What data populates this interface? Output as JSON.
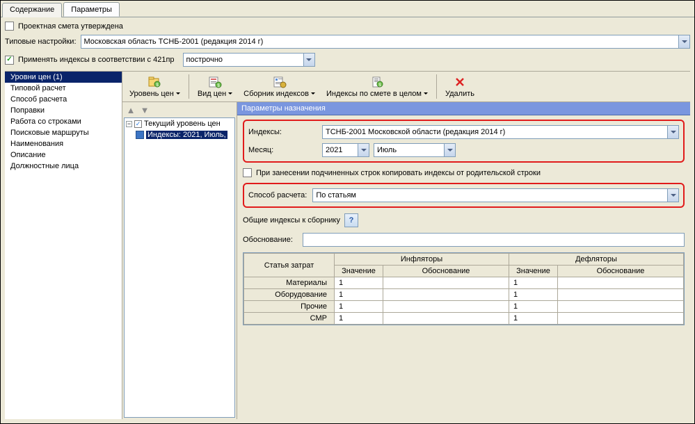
{
  "tabs": {
    "content": "Содержание",
    "params": "Параметры"
  },
  "approved_label": "Проектная смета утверждена",
  "typical_settings_label": "Типовые настройки:",
  "typical_settings_value": "Московская область ТСНБ-2001 (редакция 2014 г)",
  "apply_indexes_label": "Применять индексы в соответствии с 421пр",
  "apply_mode_value": "построчно",
  "leftnav": [
    "Уровни цен (1)",
    "Типовой расчет",
    "Способ расчета",
    "Поправки",
    "Работа со строками",
    "Поисковые маршруты",
    "Наименования",
    "Описание",
    "Должностные лица"
  ],
  "leftnav_selected": 0,
  "toolbar": {
    "level": "Уровень цен",
    "viewtype": "Вид цен",
    "indexbook": "Сборник индексов",
    "estimate_indexes": "Индексы по смете в целом",
    "delete": "Удалить"
  },
  "tree": {
    "root": "Текущий уровень цен",
    "child": "Индексы: 2021, Июль,"
  },
  "params_header": "Параметры назначения",
  "form": {
    "indexes_label": "Индексы:",
    "indexes_value": "ТСНБ-2001 Московской области (редакция 2014 г)",
    "month_label": "Месяц:",
    "year_value": "2021",
    "month_value": "Июль",
    "copy_checkbox_label": "При занесении подчиненных строк копировать индексы от родительской строки",
    "calc_method_label": "Способ расчета:",
    "calc_method_value": "По статьям",
    "general_indexes_label": "Общие индексы к сборнику",
    "justification_label": "Обоснование:",
    "justification_value": ""
  },
  "table": {
    "cost_item_hdr": "Статья затрат",
    "inflators_hdr": "Инфляторы",
    "deflators_hdr": "Дефляторы",
    "value_hdr": "Значение",
    "justif_hdr": "Обоснование",
    "rows": [
      {
        "name": "Материалы",
        "infl_val": "1",
        "infl_just": "",
        "defl_val": "1",
        "defl_just": ""
      },
      {
        "name": "Оборудование",
        "infl_val": "1",
        "infl_just": "",
        "defl_val": "1",
        "defl_just": ""
      },
      {
        "name": "Прочие",
        "infl_val": "1",
        "infl_just": "",
        "defl_val": "1",
        "defl_just": ""
      },
      {
        "name": "СМР",
        "infl_val": "1",
        "infl_just": "",
        "defl_val": "1",
        "defl_just": ""
      }
    ]
  }
}
